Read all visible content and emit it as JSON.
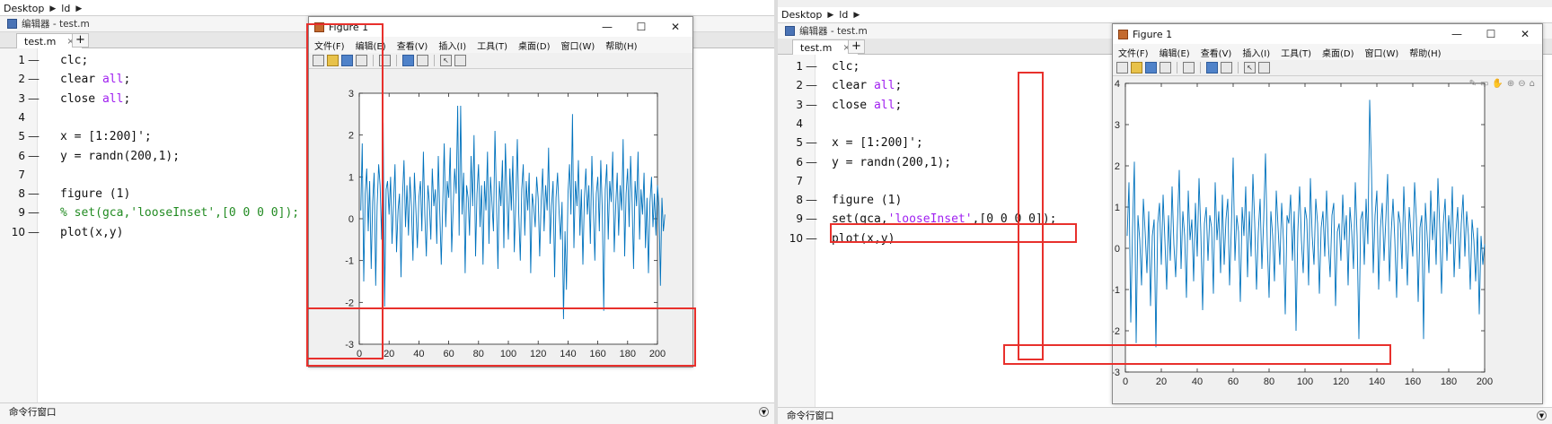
{
  "left": {
    "breadcrumb": [
      "Desktop",
      "ld"
    ],
    "editor_title": "编辑器 - test.m",
    "tab_label": "test.m",
    "tab_close": "×",
    "tab_add": "+",
    "code_lines": [
      {
        "n": "1",
        "parts": [
          {
            "t": "clc;",
            "c": ""
          }
        ]
      },
      {
        "n": "2",
        "parts": [
          {
            "t": "clear ",
            "c": ""
          },
          {
            "t": "all",
            "c": "kw-str"
          },
          {
            "t": ";",
            "c": ""
          }
        ]
      },
      {
        "n": "3",
        "parts": [
          {
            "t": "close ",
            "c": ""
          },
          {
            "t": "all",
            "c": "kw-str"
          },
          {
            "t": ";",
            "c": ""
          }
        ]
      },
      {
        "n": "4",
        "parts": [
          {
            "t": "",
            "c": ""
          }
        ]
      },
      {
        "n": "5",
        "parts": [
          {
            "t": "x = [1:200]';",
            "c": ""
          }
        ]
      },
      {
        "n": "6",
        "parts": [
          {
            "t": "y = randn(200,1);",
            "c": ""
          }
        ]
      },
      {
        "n": "7",
        "parts": [
          {
            "t": "",
            "c": ""
          }
        ]
      },
      {
        "n": "8",
        "parts": [
          {
            "t": "figure (1)",
            "c": ""
          }
        ]
      },
      {
        "n": "9",
        "parts": [
          {
            "t": "% set(gca,'looseInset',[0 0 0 0]);",
            "c": "cmt"
          }
        ]
      },
      {
        "n": "10",
        "parts": [
          {
            "t": "plot(x,y)",
            "c": ""
          }
        ]
      }
    ],
    "line_dash": "—",
    "command_window": "命令行窗口",
    "figure_title": "Figure 1",
    "menu": [
      "文件(F)",
      "编辑(E)",
      "查看(V)",
      "插入(I)",
      "工具(T)",
      "桌面(D)",
      "窗口(W)",
      "帮助(H)"
    ],
    "win_buttons": [
      "—",
      "☐",
      "✕"
    ]
  },
  "right": {
    "breadcrumb": [
      "Desktop",
      "ld"
    ],
    "editor_title": "编辑器 - test.m",
    "tab_label": "test.m",
    "tab_close": "×",
    "tab_add": "+",
    "code_lines": [
      {
        "n": "1",
        "parts": [
          {
            "t": "clc;",
            "c": ""
          }
        ]
      },
      {
        "n": "2",
        "parts": [
          {
            "t": "clear ",
            "c": ""
          },
          {
            "t": "all",
            "c": "kw-str"
          },
          {
            "t": ";",
            "c": ""
          }
        ]
      },
      {
        "n": "3",
        "parts": [
          {
            "t": "close ",
            "c": ""
          },
          {
            "t": "all",
            "c": "kw-str"
          },
          {
            "t": ";",
            "c": ""
          }
        ]
      },
      {
        "n": "4",
        "parts": [
          {
            "t": "",
            "c": ""
          }
        ]
      },
      {
        "n": "5",
        "parts": [
          {
            "t": "x = [1:200]';",
            "c": ""
          }
        ]
      },
      {
        "n": "6",
        "parts": [
          {
            "t": "y = randn(200,1);",
            "c": ""
          }
        ]
      },
      {
        "n": "7",
        "parts": [
          {
            "t": "",
            "c": ""
          }
        ]
      },
      {
        "n": "8",
        "parts": [
          {
            "t": "figure (1)",
            "c": ""
          }
        ]
      },
      {
        "n": "9",
        "parts": [
          {
            "t": "set(gca,",
            "c": ""
          },
          {
            "t": "'looseInset'",
            "c": "kw-str"
          },
          {
            "t": ",[0 0 0 0]);",
            "c": ""
          }
        ]
      },
      {
        "n": "10",
        "parts": [
          {
            "t": "plot(x,y)",
            "c": ""
          }
        ]
      }
    ],
    "line_dash": "—",
    "command_window": "命令行窗口",
    "figure_title": "Figure 1",
    "menu": [
      "文件(F)",
      "编辑(E)",
      "查看(V)",
      "插入(I)",
      "工具(T)",
      "桌面(D)",
      "窗口(W)",
      "帮助(H)"
    ],
    "win_buttons": [
      "—",
      "☐",
      "✕"
    ]
  },
  "colors": {
    "line": "#0072bd",
    "highlight": "#e8302c",
    "string": "#a020f0",
    "comment": "#228b22"
  },
  "chart_data": [
    {
      "type": "line",
      "xlim": [
        0,
        200
      ],
      "ylim": [
        -3,
        3
      ],
      "xticks": [
        0,
        20,
        40,
        60,
        80,
        100,
        120,
        140,
        160,
        180,
        200
      ],
      "yticks": [
        -3,
        -2,
        -1,
        0,
        1,
        2,
        3
      ],
      "x": "1..200",
      "y": [
        0.2,
        1.8,
        -1.5,
        0.6,
        1.2,
        -0.3,
        0.9,
        -1.2,
        0.4,
        1.1,
        -1.6,
        0.3,
        1.3,
        0.8,
        -0.5,
        2.3,
        -2.1,
        0.7,
        0.9,
        0.1,
        1.0,
        -0.6,
        0.4,
        1.3,
        -0.8,
        0.2,
        0.6,
        -1.4,
        0.5,
        1.4,
        -0.2,
        0.8,
        -0.4,
        1.0,
        0.3,
        -1.0,
        1.1,
        0.2,
        -0.7,
        0.5,
        0.9,
        -0.3,
        1.6,
        0.1,
        -0.9,
        0.8,
        0.4,
        -0.5,
        1.2,
        0.3,
        0.7,
        -0.6,
        1.5,
        0.2,
        -1.1,
        0.4,
        1.8,
        -0.2,
        0.9,
        0.5,
        1.7,
        -0.8,
        0.3,
        1.2,
        0.6,
        2.7,
        -0.4,
        2.7,
        0.1,
        1.1,
        -1.3,
        0.8,
        0.5,
        -0.4,
        1.5,
        0.3,
        2.0,
        -0.9,
        0.6,
        1.3,
        -0.2,
        0.8,
        -1.1,
        0.9,
        0.2,
        1.6,
        -0.6,
        1.0,
        0.4,
        -0.3,
        2.1,
        0.5,
        -1.2,
        0.9,
        0.3,
        1.4,
        -0.7,
        1.8,
        0.6,
        -0.5,
        1.2,
        0.2,
        1.5,
        -0.8,
        0.4,
        1.9,
        0.1,
        -1.0,
        0.7,
        1.3,
        -0.4,
        0.9,
        0.2,
        1.1,
        -1.3,
        0.6,
        0.3,
        -0.2,
        1.0,
        0.5,
        -0.9,
        0.4,
        1.2,
        -0.3,
        0.8,
        0.2,
        1.7,
        -0.6,
        0.3,
        0.9,
        -1.4,
        0.5,
        1.1,
        0.2,
        -0.5,
        0.4,
        -2.4,
        -0.3,
        -1.7,
        0.6,
        1.3,
        0.1,
        2.5,
        -0.7,
        0.9,
        0.3,
        1.4,
        -0.4,
        0.7,
        -1.1,
        0.5,
        1.2,
        0.1,
        0.8,
        -0.6,
        1.5,
        0.3,
        -1.0,
        0.6,
        1.0,
        -0.3,
        1.4,
        0.2,
        -2.2,
        0.7,
        1.3,
        -0.5,
        0.9,
        0.4,
        1.6,
        -0.8,
        0.3,
        1.1,
        -0.4,
        0.8,
        0.2,
        1.9,
        -0.9,
        0.6,
        1.2,
        -0.2,
        1.5,
        0.4,
        -1.2,
        0.9,
        0.3,
        1.6,
        -0.5,
        0.7,
        0.1,
        1.1,
        -0.7,
        0.5,
        -1.3,
        0.4,
        1.0,
        -0.2,
        0.6,
        -0.4,
        0.8,
        0.3,
        -1.6,
        0.5,
        -0.3,
        0.1
      ]
    },
    {
      "type": "line",
      "xlim": [
        0,
        200
      ],
      "ylim": [
        -3,
        4
      ],
      "xticks": [
        0,
        20,
        40,
        60,
        80,
        100,
        120,
        140,
        160,
        180,
        200
      ],
      "yticks": [
        -3,
        -2,
        -1,
        0,
        1,
        2,
        3,
        4
      ],
      "x": "1..200",
      "y": [
        0.3,
        1.6,
        -1.8,
        0.5,
        2.1,
        -2.3,
        0.8,
        0.2,
        -0.9,
        1.2,
        0.4,
        -0.6,
        0.9,
        -1.4,
        0.3,
        0.7,
        -2.4,
        0.6,
        1.1,
        -0.4,
        1.3,
        0.2,
        -1.0,
        0.8,
        -0.3,
        1.5,
        0.1,
        -0.7,
        0.6,
        1.9,
        -0.5,
        0.9,
        0.3,
        -1.2,
        1.4,
        0.2,
        0.7,
        -0.8,
        1.1,
        -0.2,
        1.7,
        0.4,
        -1.5,
        0.6,
        1.0,
        -0.3,
        0.8,
        0.5,
        -1.1,
        1.6,
        0.2,
        0.9,
        -0.6,
        1.3,
        -0.4,
        0.7,
        1.2,
        -0.9,
        0.5,
        2.2,
        -0.3,
        0.8,
        0.4,
        -1.3,
        1.0,
        0.3,
        1.5,
        -0.7,
        0.9,
        -0.2,
        1.8,
        0.6,
        -1.0,
        0.4,
        1.2,
        -0.5,
        0.7,
        2.3,
        0.1,
        -1.2,
        0.9,
        0.3,
        -0.8,
        1.4,
        0.5,
        -0.4,
        1.1,
        0.2,
        -1.6,
        0.8,
        0.6,
        1.3,
        -0.3,
        0.9,
        -2.0,
        0.4,
        1.5,
        0.2,
        -0.6,
        1.0,
        0.7,
        -0.9,
        1.7,
        0.3,
        -0.4,
        1.2,
        0.6,
        -1.1,
        0.5,
        0.9,
        -0.2,
        1.4,
        0.1,
        -0.7,
        0.8,
        1.1,
        -1.4,
        0.4,
        0.6,
        -0.3,
        1.3,
        0.2,
        0.8,
        -0.9,
        1.0,
        0.4,
        -0.5,
        1.6,
        0.3,
        -2.2,
        0.7,
        0.9,
        -0.4,
        1.2,
        0.1,
        3.6,
        1.9,
        -0.6,
        0.8,
        1.4,
        -1.0,
        0.5,
        1.1,
        -0.3,
        0.7,
        1.8,
        -0.8,
        0.4,
        1.2,
        0.2,
        -1.2,
        0.9,
        0.6,
        -0.5,
        1.5,
        0.3,
        -0.9,
        1.0,
        0.4,
        -0.2,
        1.6,
        0.7,
        -1.3,
        0.5,
        0.8,
        -2.2,
        1.1,
        0.3,
        -0.6,
        1.4,
        0.2,
        0.9,
        -0.4,
        1.7,
        0.5,
        -1.1,
        0.6,
        1.2,
        -0.3,
        0.8,
        0.1,
        1.5,
        -0.7,
        0.4,
        1.0,
        -0.5,
        0.6,
        1.3,
        -0.2,
        0.9,
        0.3,
        -1.0,
        0.7,
        0.2,
        -0.8,
        0.5,
        -1.6,
        0.3,
        -0.4,
        0.1
      ]
    }
  ]
}
